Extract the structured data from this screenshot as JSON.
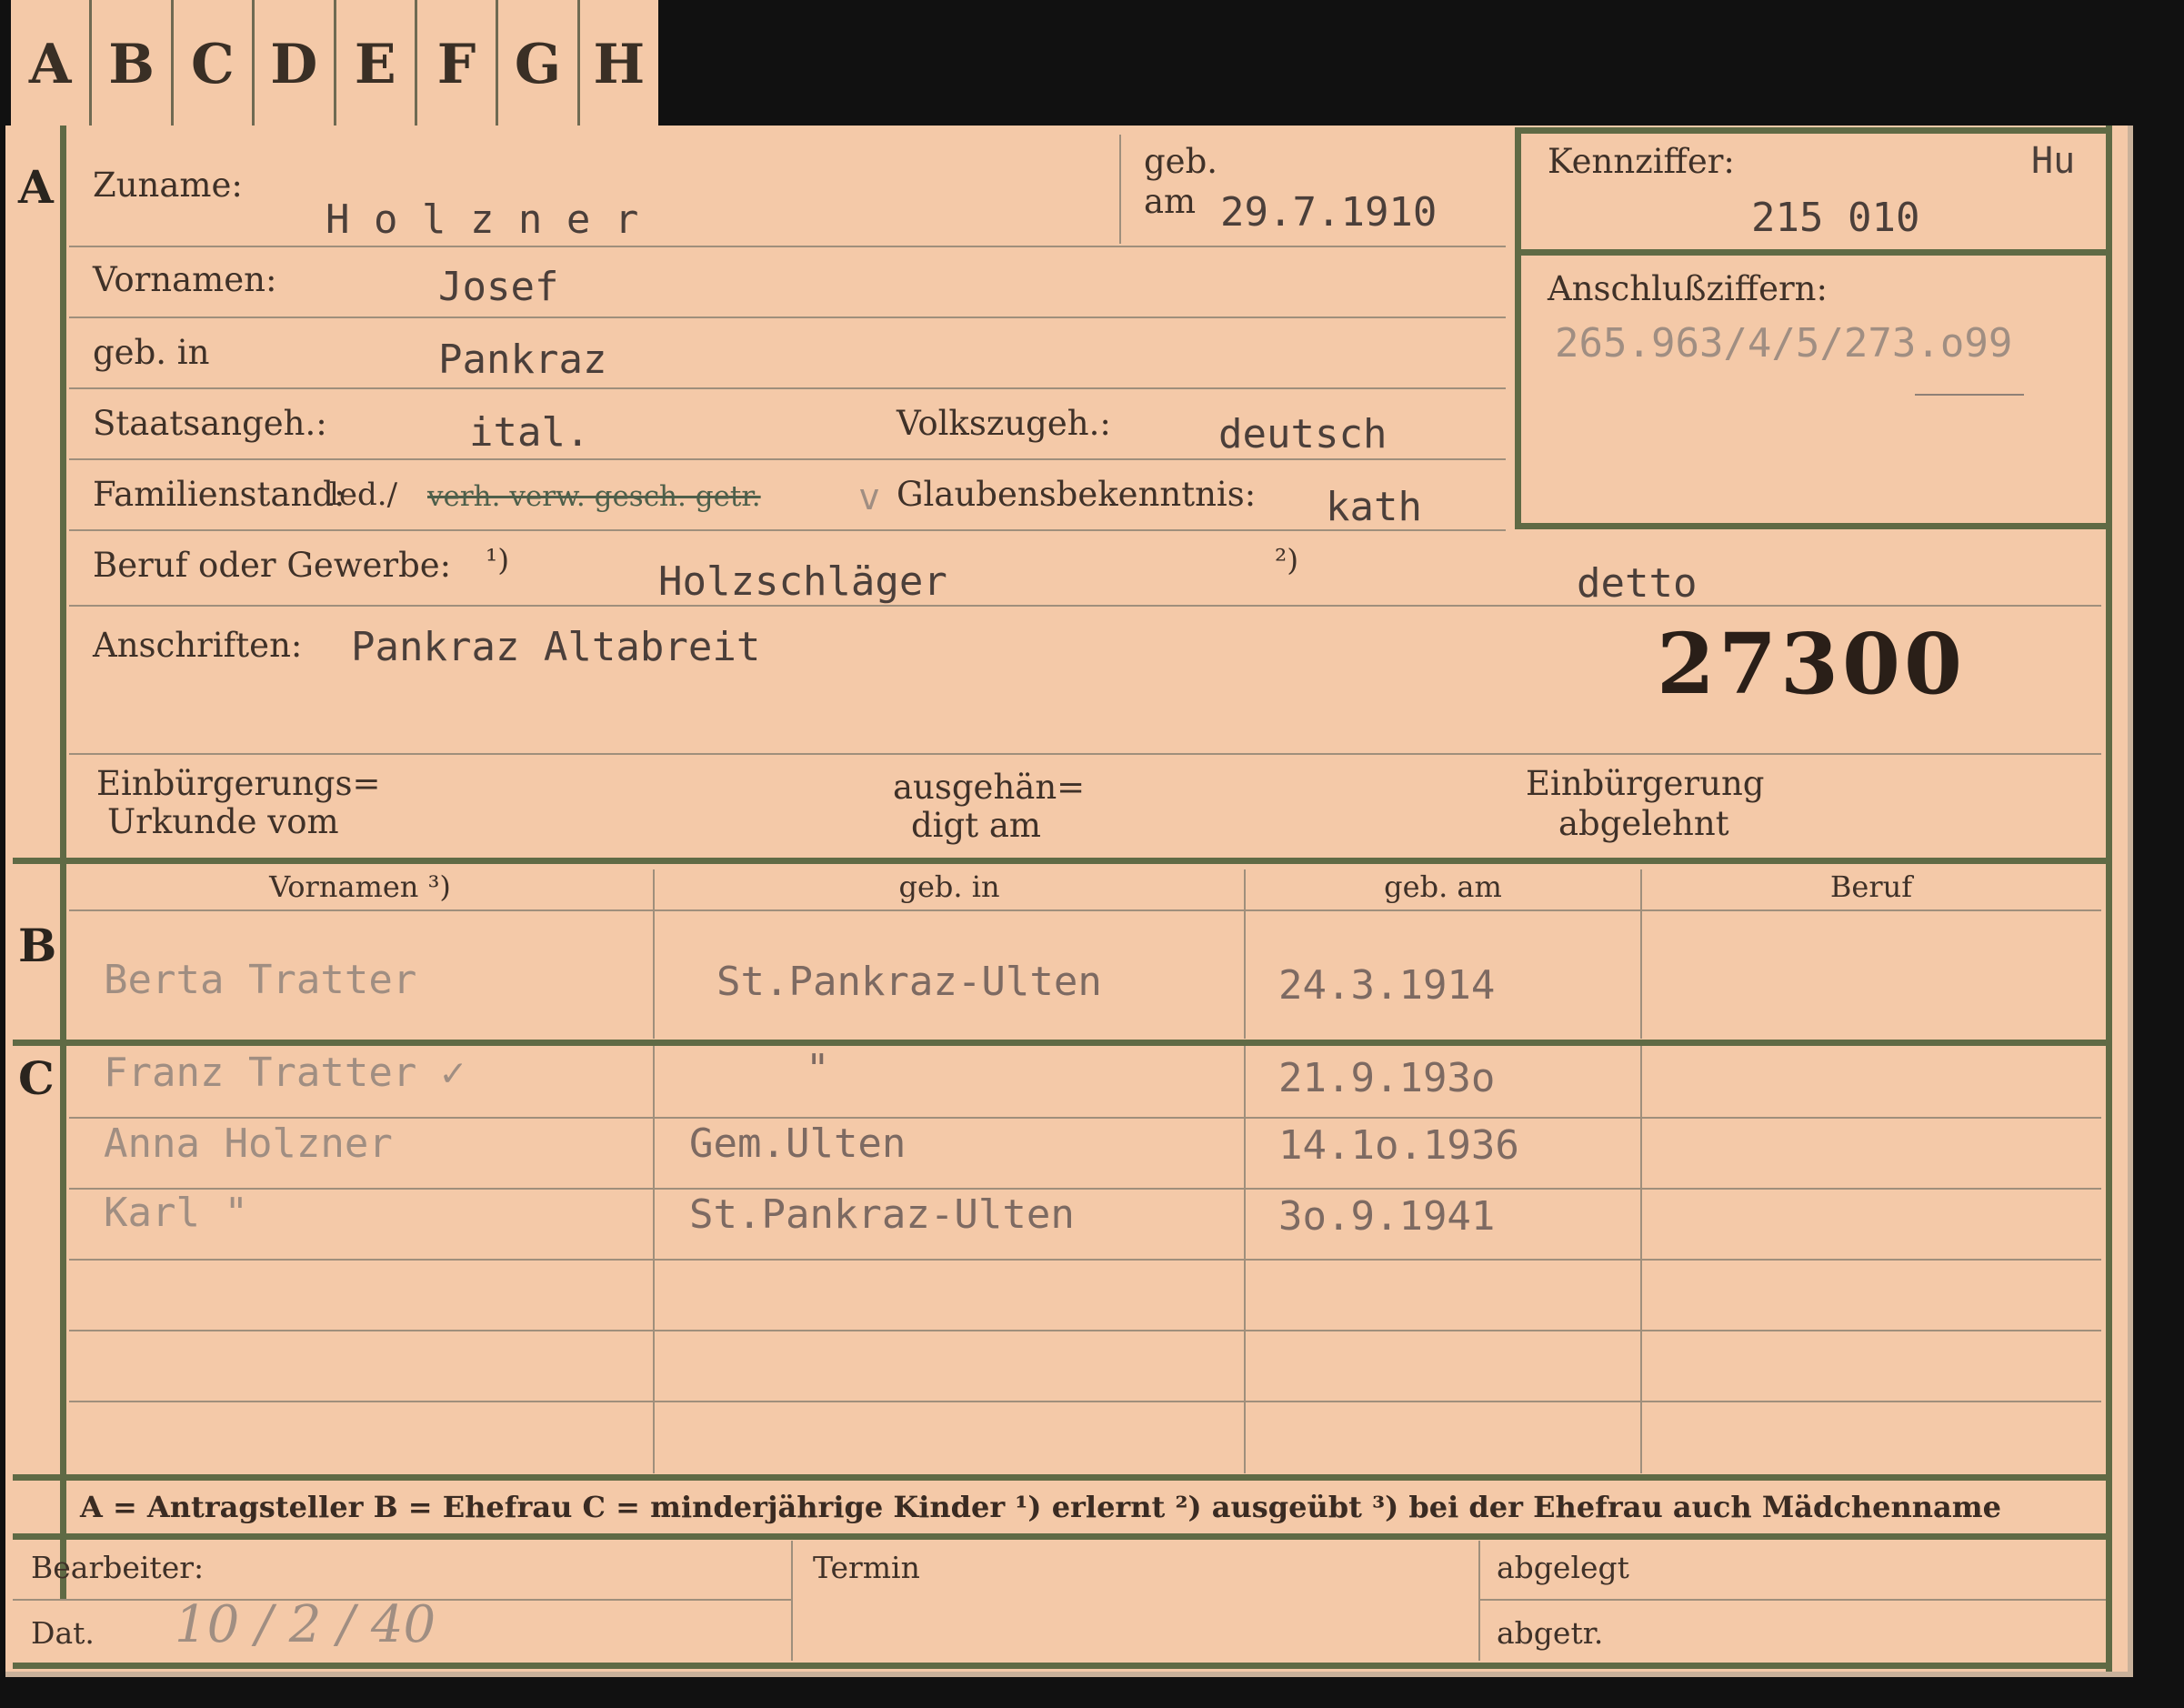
{
  "tabs": [
    "A",
    "B",
    "C",
    "D",
    "E",
    "F",
    "G",
    "H"
  ],
  "section_markers": {
    "a": "A",
    "b": "B",
    "c": "C"
  },
  "labels": {
    "zuname": "Zuname:",
    "geb": "geb.",
    "am": "am",
    "kennziffer": "Kennziffer:",
    "vornamen": "Vornamen:",
    "anschlussziffern": "Anschlußziffern:",
    "geb_in": "geb. in",
    "staatsangeh": "Staatsangeh.:",
    "volkszugeh": "Volkszugeh.:",
    "familienstand": "Familienstand:",
    "glaubensbekenntnis": "Glaubensbekenntnis:",
    "beruf_gewerbe": "Beruf oder Gewerbe:",
    "mark1": "¹)",
    "mark2": "²)",
    "anschriften": "Anschriften:",
    "einb_urkunde_1": "Einbürgerungs=",
    "einb_urkunde_2": "Urkunde vom",
    "ausgeh_1": "ausgehän=",
    "ausgeh_2": "digt am",
    "einb_abgel_1": "Einbürgerung",
    "einb_abgel_2": "abgelehnt"
  },
  "values": {
    "zuname": "H o l z n e r",
    "geb_am": "29.7.1910",
    "kennziffer_prefix": "Hu",
    "kennziffer": "215 010",
    "vornamen": "Josef",
    "anschlussziffern": "265.963/4/5/273.o99",
    "geb_in": "Pankraz",
    "staatsangeh": "ital.",
    "volkszugeh": "deutsch",
    "familienstand_prefix": "led./",
    "familienstand_struck": "verh. verw. gesch. getr.",
    "familienstand_extra": "v",
    "glaubensbekenntnis": "kath",
    "beruf_erlernt": "Holzschläger",
    "beruf_ausgeuebt": "detto",
    "anschriften": "Pankraz Altabreit",
    "number": "27300"
  },
  "table": {
    "headers": [
      "Vornamen ³)",
      "geb. in",
      "geb. am",
      "Beruf"
    ],
    "rows": [
      {
        "name": "Berta Tratter",
        "place": "St.Pankraz-Ulten",
        "date": "24.3.1914",
        "beruf": ""
      },
      {
        "name": "Franz Tratter ✓",
        "place": "\"",
        "date": "21.9.193o",
        "beruf": ""
      },
      {
        "name": "Anna Holzner",
        "place": "Gem.Ulten",
        "date": "14.1o.1936",
        "beruf": ""
      },
      {
        "name": "Karl      \"",
        "place": "St.Pankraz-Ulten",
        "date": "3o.9.1941",
        "beruf": ""
      },
      {
        "name": "",
        "place": "",
        "date": "",
        "beruf": ""
      },
      {
        "name": "",
        "place": "",
        "date": "",
        "beruf": ""
      },
      {
        "name": "",
        "place": "",
        "date": "",
        "beruf": ""
      }
    ]
  },
  "legend": "A = Antragsteller    B = Ehefrau    C = minderjährige Kinder    ¹) erlernt    ²) ausgeübt    ³) bei der Ehefrau auch Mädchenname",
  "footer": {
    "bearbeiter": "Bearbeiter:",
    "termin": "Termin",
    "abgelegt": "abgelegt",
    "dat": "Dat.",
    "dat_value": "10 / 2 / 40",
    "abgetr": "abgetr."
  },
  "colors": {
    "card": "#f4c9a8",
    "border_green": "#5f6a45",
    "background": "#111111"
  }
}
